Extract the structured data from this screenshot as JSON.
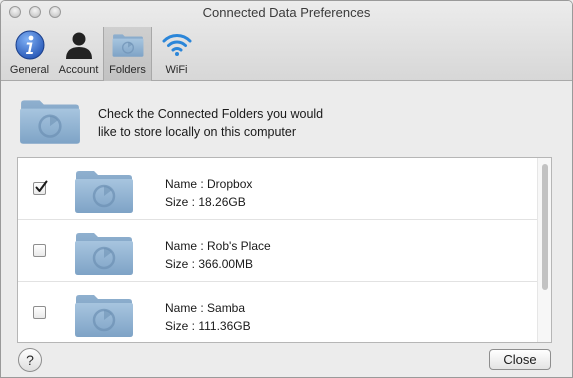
{
  "window": {
    "title": "Connected Data Preferences"
  },
  "toolbar": {
    "items": [
      {
        "label": "General",
        "icon": "info-icon"
      },
      {
        "label": "Account",
        "icon": "user-silhouette-icon"
      },
      {
        "label": "Folders",
        "icon": "folder-icon",
        "selected": true
      },
      {
        "label": "WiFi",
        "icon": "wifi-icon"
      }
    ]
  },
  "header": {
    "text_line1": "Check the Connected Folders you would",
    "text_line2": "like to store locally on this computer"
  },
  "folders": [
    {
      "name": "Name : Dropbox",
      "size": "Size : 18.26GB",
      "checked": true
    },
    {
      "name": "Name : Rob's Place",
      "size": "Size : 366.00MB",
      "checked": false
    },
    {
      "name": "Name : Samba",
      "size": "Size : 111.36GB",
      "checked": false
    }
  ],
  "buttons": {
    "help_label": "?",
    "close_label": "Close"
  },
  "colors": {
    "folder_blue": "#8fb3d3",
    "info_blue": "#2a62c7",
    "wifi_blue": "#2b86d9"
  }
}
